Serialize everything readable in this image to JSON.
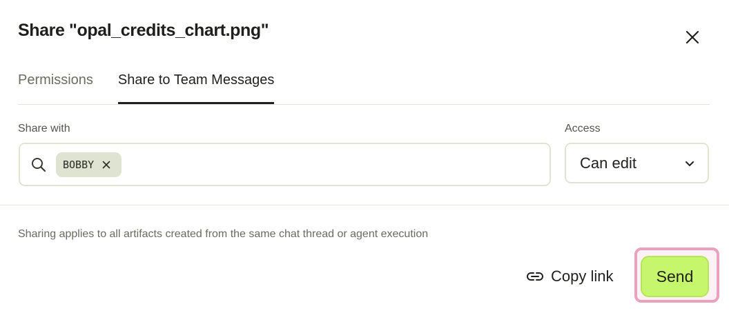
{
  "dialog": {
    "title": "Share \"opal_credits_chart.png\"",
    "close_icon": "close-icon"
  },
  "tabs": [
    {
      "label": "Permissions",
      "active": false
    },
    {
      "label": "Share to Team Messages",
      "active": true
    }
  ],
  "share_with": {
    "label": "Share with",
    "search_icon": "search-icon",
    "chips": [
      {
        "label": "BOBBY",
        "remove_icon": "close-icon"
      }
    ]
  },
  "access": {
    "label": "Access",
    "value": "Can edit",
    "icon": "chevron-down-icon"
  },
  "note": "Sharing applies to all artifacts created from the same chat thread or agent execution",
  "footer": {
    "copy_link_label": "Copy link",
    "copy_link_icon": "link-icon",
    "send_label": "Send"
  },
  "colors": {
    "send_button": "#c6f66c",
    "focus_ring": "#e8a2bd",
    "chip_background": "#dfe4d2",
    "input_border": "#e2e3d3"
  }
}
